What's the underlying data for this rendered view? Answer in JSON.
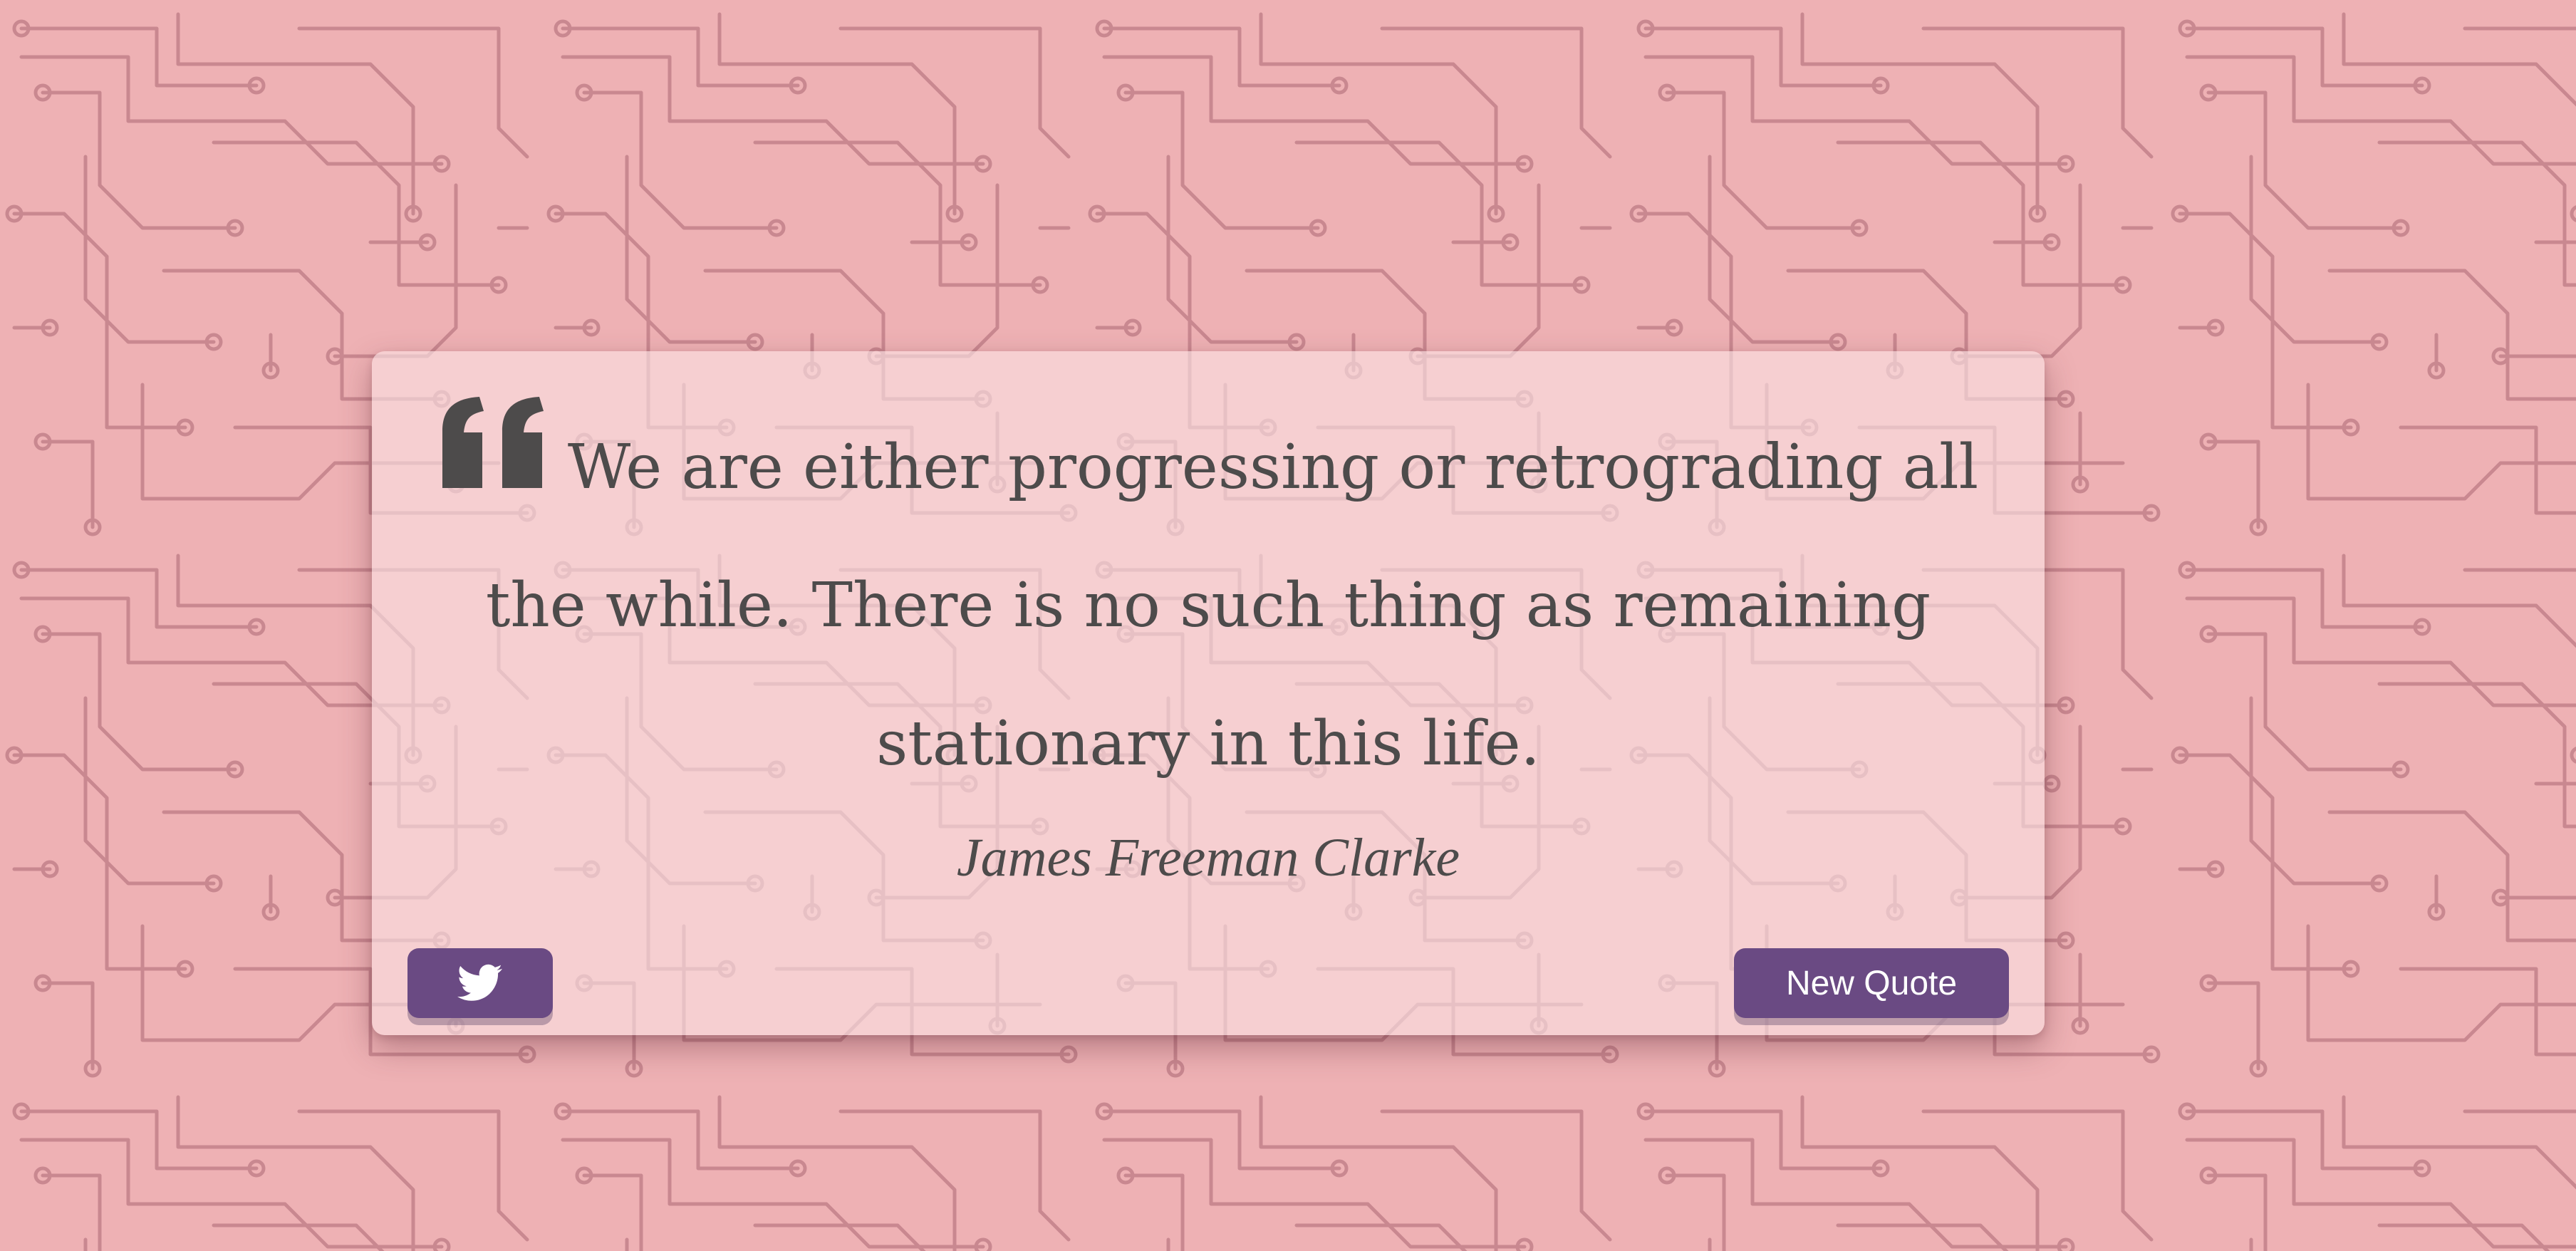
{
  "quote": {
    "text": "We are either progressing or retrograding all the while. There is no such thing as remaining stationary in this life.",
    "author": "James Freeman Clarke"
  },
  "actions": {
    "tweet_icon": "twitter-icon",
    "new_quote_label": "New Quote"
  },
  "colors": {
    "background": "#eeb1b4",
    "circuit_lines": "#c98890",
    "card": "#f9e2e3",
    "text": "#4d4b4b",
    "button": "#6a4a83"
  }
}
